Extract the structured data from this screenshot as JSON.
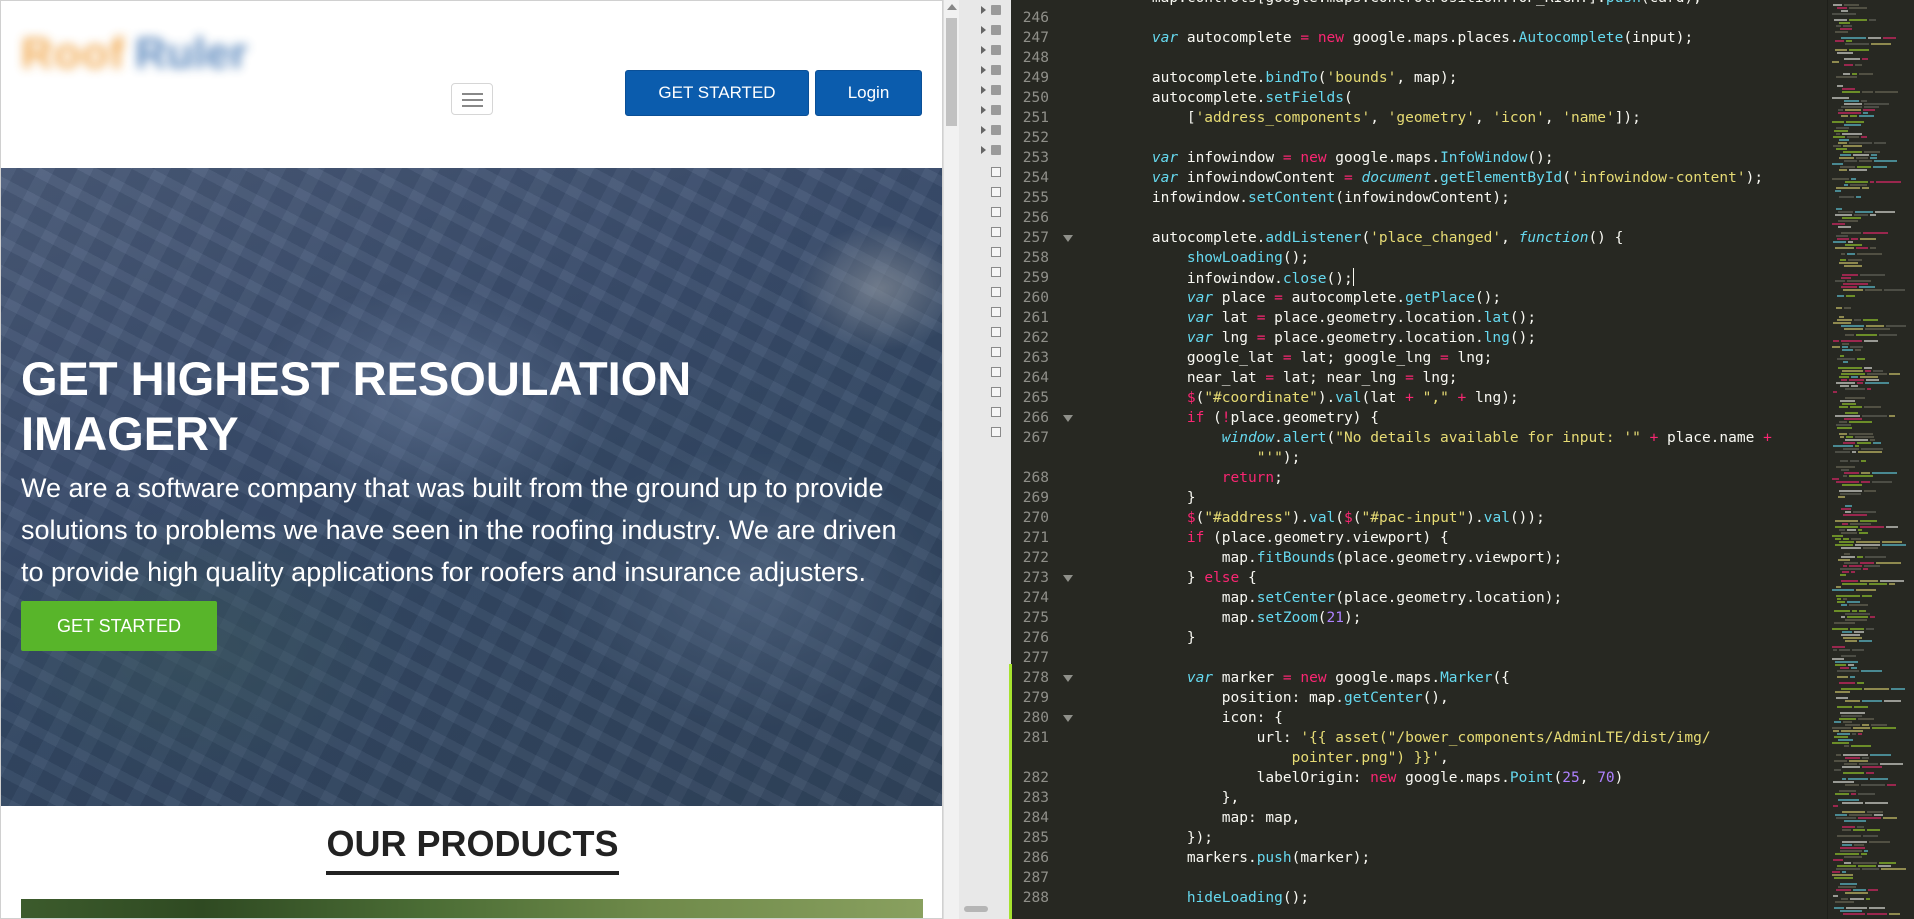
{
  "browser": {
    "header": {
      "logo_text_1": "Roof",
      "logo_text_2": "Ruler",
      "get_started_label": "GET STARTED",
      "login_label": "Login"
    },
    "hero": {
      "title": "GET HIGHEST RESOULATION IMAGERY",
      "description": "We are a software company that was built from the ground up to provide solutions to problems we have seen in the roofing industry. We are driven to provide high quality applications for roofers and insurance adjusters.",
      "cta_label": "GET STARTED"
    },
    "products": {
      "heading": "OUR PRODUCTS"
    }
  },
  "editor": {
    "line_numbers": [
      246,
      247,
      248,
      249,
      250,
      251,
      252,
      253,
      254,
      255,
      256,
      257,
      258,
      259,
      260,
      261,
      262,
      263,
      264,
      265,
      266,
      267,
      268,
      269,
      270,
      271,
      272,
      273,
      274,
      275,
      276,
      277,
      278,
      279,
      280,
      281,
      282,
      283,
      284,
      285,
      286,
      287,
      288
    ],
    "top_partial_line": "map.controls[google.maps.ControlPosition.TOP_RIGHT].push(card);"
  },
  "colors": {
    "brand_blue": "#0b5cad",
    "cta_green": "#58b52a",
    "editor_bg": "#272822",
    "keyword": "#f92672",
    "string": "#e6db74",
    "function": "#66d9ef",
    "number": "#ae81ff"
  }
}
